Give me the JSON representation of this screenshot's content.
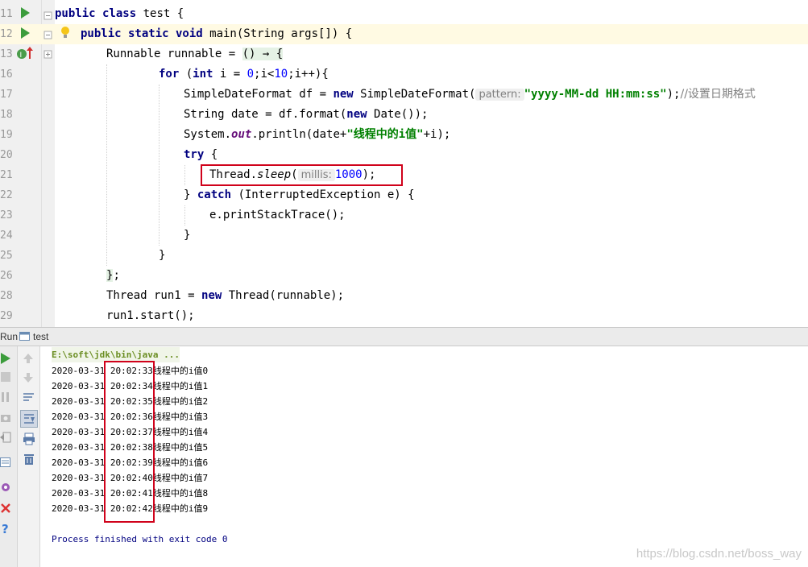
{
  "editor": {
    "line_numbers": [
      "11",
      "12",
      "13",
      "16",
      "17",
      "18",
      "19",
      "20",
      "21",
      "22",
      "23",
      "24",
      "25",
      "26",
      "28",
      "29"
    ],
    "lines": [
      {
        "kw1": "public class",
        "t1": " test {"
      },
      {
        "kw1": "public static void",
        "t1": " main(String args[]) {"
      },
      {
        "t1": "Runnable runnable = ",
        "t2": "() → {"
      },
      {
        "kw1": "for",
        "t1": " (",
        "kw2": "int",
        "t2": " i = ",
        "n1": "0",
        "t3": ";i<",
        "n2": "10",
        "t4": ";i++){"
      },
      {
        "t1": "SimpleDateFormat df = ",
        "kw1": "new",
        "t2": " SimpleDateFormat(",
        "hint": "pattern:",
        "str": "\"yyyy-MM-dd HH:mm:ss\"",
        "t3": ");",
        "cmt": "//设置日期格式"
      },
      {
        "t1": "String date = df.format(",
        "kw1": "new",
        "t2": " Date());"
      },
      {
        "t1": "System.",
        "fld": "out",
        "t2": ".println(date+",
        "str": "\"线程中的i值\"",
        "t3": "+i);"
      },
      {
        "kw1": "try",
        "t1": " {"
      },
      {
        "t1": "Thread.",
        "it": "sleep",
        "t2": "(",
        "hint": "millis:",
        "n1": "1000",
        "t3": ");"
      },
      {
        "t1": "} ",
        "kw1": "catch",
        "t2": " (InterruptedException e) {"
      },
      {
        "t1": "e.printStackTrace();"
      },
      {
        "t1": "}"
      },
      {
        "t1": "}"
      },
      {
        "t1": "}",
        "t2": ";"
      },
      {
        "t1": "Thread run1 = ",
        "kw1": "new",
        "t2": " Thread(runnable);"
      },
      {
        "t1": "run1.start();"
      }
    ]
  },
  "run_panel": {
    "run_label": "Run",
    "tab_label": "test",
    "command": "E:\\soft\\jdk\\bin\\java ...",
    "output": [
      "2020-03-31 20:02:33线程中的i值0",
      "2020-03-31 20:02:34线程中的i值1",
      "2020-03-31 20:02:35线程中的i值2",
      "2020-03-31 20:02:36线程中的i值3",
      "2020-03-31 20:02:37线程中的i值4",
      "2020-03-31 20:02:38线程中的i值5",
      "2020-03-31 20:02:39线程中的i值6",
      "2020-03-31 20:02:40线程中的i值7",
      "2020-03-31 20:02:41线程中的i值8",
      "2020-03-31 20:02:42线程中的i值9"
    ],
    "exit_message": "Process finished with exit code 0"
  },
  "watermark": "https://blog.csdn.net/boss_way",
  "colors": {
    "keyword": "#000080",
    "string": "#008000",
    "number": "#0000ff",
    "highlight_box": "#d0021b"
  }
}
